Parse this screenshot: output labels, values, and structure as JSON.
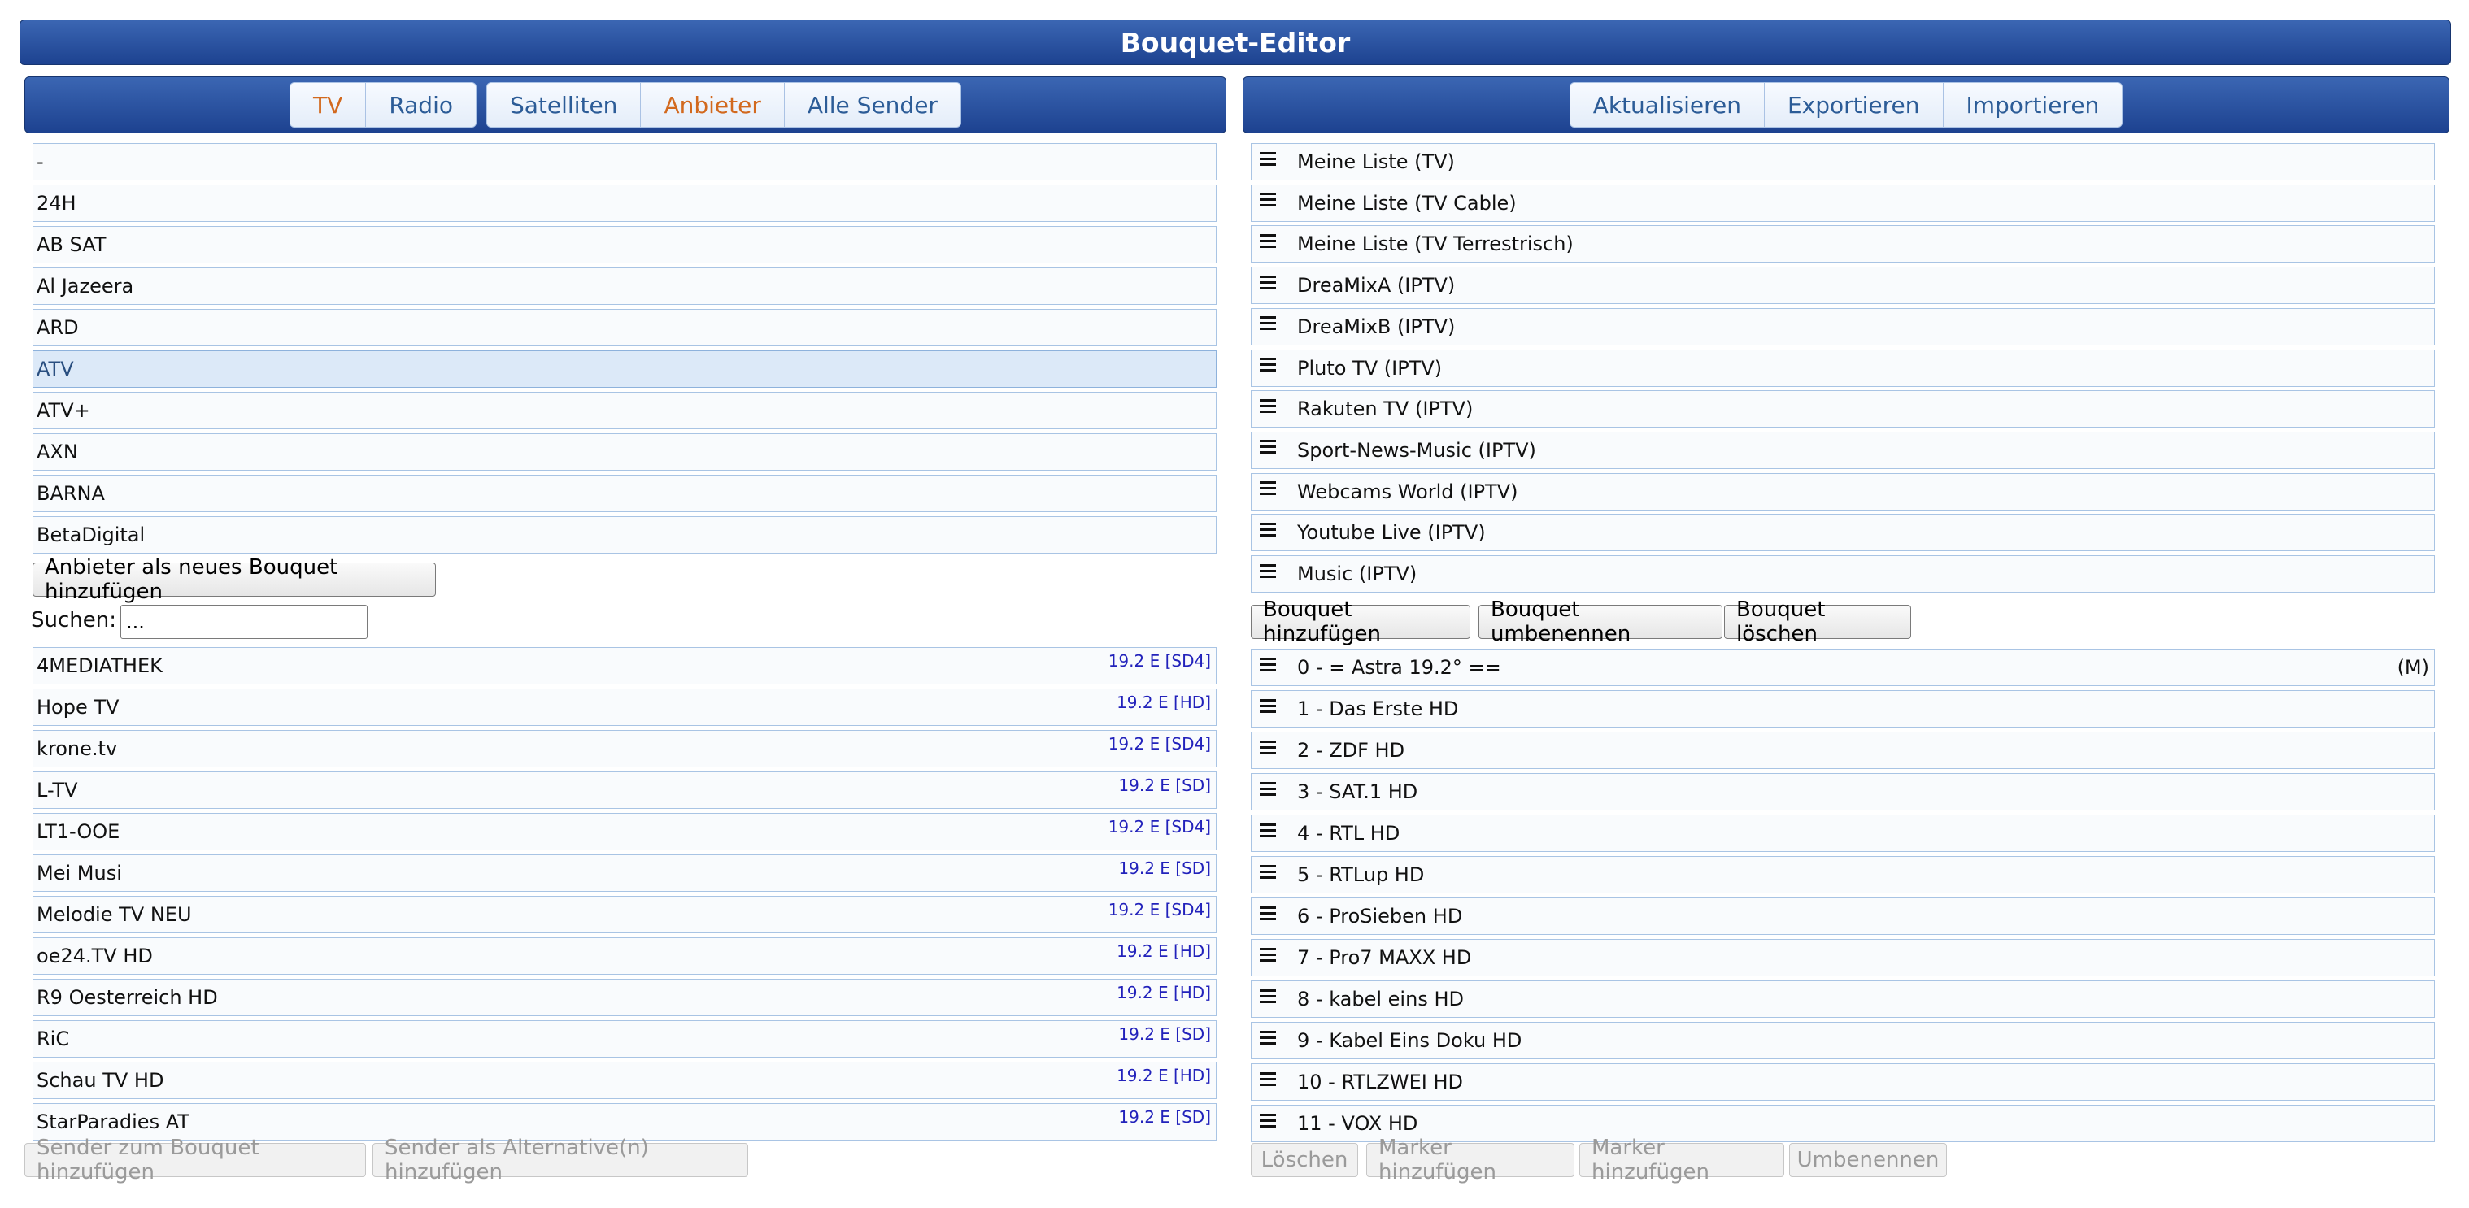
{
  "title": "Bouquet-Editor",
  "left_toolbar": {
    "group1": [
      {
        "label": "TV",
        "active": true
      },
      {
        "label": "Radio",
        "active": false
      }
    ],
    "group2": [
      {
        "label": "Satelliten",
        "active": false
      },
      {
        "label": "Anbieter",
        "active": true
      },
      {
        "label": "Alle Sender",
        "active": false
      }
    ]
  },
  "right_toolbar": {
    "buttons": [
      "Aktualisieren",
      "Exportieren",
      "Importieren"
    ]
  },
  "providers": [
    {
      "label": "-",
      "selected": false
    },
    {
      "label": "24H",
      "selected": false
    },
    {
      "label": "AB SAT",
      "selected": false
    },
    {
      "label": "Al Jazeera",
      "selected": false
    },
    {
      "label": "ARD",
      "selected": false
    },
    {
      "label": "ATV",
      "selected": true
    },
    {
      "label": "ATV+",
      "selected": false
    },
    {
      "label": "AXN",
      "selected": false
    },
    {
      "label": "BARNA",
      "selected": false
    },
    {
      "label": "BetaDigital",
      "selected": false
    }
  ],
  "add_provider_button": "Anbieter als neues Bouquet hinzufügen",
  "search": {
    "label": "Suchen:",
    "value": "..."
  },
  "channels": [
    {
      "name": "4MEDIATHEK",
      "tag": "19.2 E [SD4]"
    },
    {
      "name": "Hope TV",
      "tag": "19.2 E [HD]"
    },
    {
      "name": "krone.tv",
      "tag": "19.2 E [SD4]"
    },
    {
      "name": "L-TV",
      "tag": "19.2 E [SD]"
    },
    {
      "name": "LT1-OOE",
      "tag": "19.2 E [SD4]"
    },
    {
      "name": "Mei Musi",
      "tag": "19.2 E [SD]"
    },
    {
      "name": "Melodie TV NEU",
      "tag": "19.2 E [SD4]"
    },
    {
      "name": "oe24.TV HD",
      "tag": "19.2 E [HD]"
    },
    {
      "name": "R9 Oesterreich HD",
      "tag": "19.2 E [HD]"
    },
    {
      "name": "RiC",
      "tag": "19.2 E [SD]"
    },
    {
      "name": "Schau TV HD",
      "tag": "19.2 E [HD]"
    },
    {
      "name": "StarParadies AT",
      "tag": "19.2 E [SD]"
    }
  ],
  "left_bottom_buttons": [
    "Sender zum Bouquet hinzufügen",
    "Sender als Alternative(n) hinzufügen"
  ],
  "bouquets": [
    "Meine Liste (TV)",
    "Meine Liste (TV Cable)",
    "Meine Liste (TV Terrestrisch)",
    "DreaMixA (IPTV)",
    "DreaMixB (IPTV)",
    "Pluto TV (IPTV)",
    "Rakuten TV (IPTV)",
    "Sport-News-Music (IPTV)",
    "Webcams World (IPTV)",
    "Youtube Live (IPTV)",
    "Music (IPTV)"
  ],
  "bouquet_buttons": [
    "Bouquet hinzufügen",
    "Bouquet umbenennen",
    "Bouquet löschen"
  ],
  "bouquet_channels": [
    {
      "label": "0 - = Astra 19.2° ==",
      "suffix": "(M)"
    },
    {
      "label": "1 - Das Erste HD",
      "suffix": ""
    },
    {
      "label": "2 - ZDF HD",
      "suffix": ""
    },
    {
      "label": "3 - SAT.1 HD",
      "suffix": ""
    },
    {
      "label": "4 - RTL HD",
      "suffix": ""
    },
    {
      "label": "5 - RTLup HD",
      "suffix": ""
    },
    {
      "label": "6 - ProSieben HD",
      "suffix": ""
    },
    {
      "label": "7 - Pro7 MAXX HD",
      "suffix": ""
    },
    {
      "label": "8 - kabel eins HD",
      "suffix": ""
    },
    {
      "label": "9 - Kabel Eins Doku HD",
      "suffix": ""
    },
    {
      "label": "10 - RTLZWEI HD",
      "suffix": ""
    },
    {
      "label": "11 - VOX HD",
      "suffix": ""
    }
  ],
  "right_bottom_buttons": [
    "Löschen",
    "Marker hinzufügen",
    "Marker hinzufügen",
    "Umbenennen"
  ]
}
